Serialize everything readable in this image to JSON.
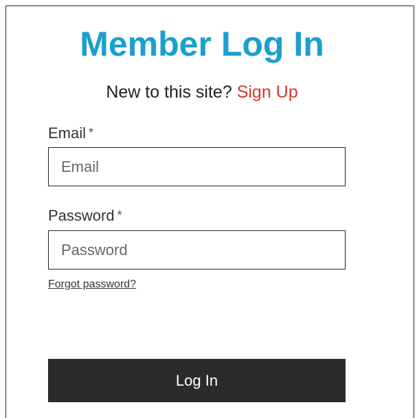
{
  "form": {
    "title": "Member Log In",
    "signup_prompt": "New to this site?",
    "signup_link": "Sign Up",
    "email": {
      "label": "Email",
      "required_mark": "*",
      "placeholder": "Email",
      "value": ""
    },
    "password": {
      "label": "Password",
      "required_mark": "*",
      "placeholder": "Password",
      "value": ""
    },
    "forgot_password": "Forgot password?",
    "submit_label": "Log In"
  },
  "colors": {
    "title": "#1a9fce",
    "signup_link": "#d6362f",
    "button_bg": "#2b2b2b",
    "button_text": "#ffffff"
  }
}
